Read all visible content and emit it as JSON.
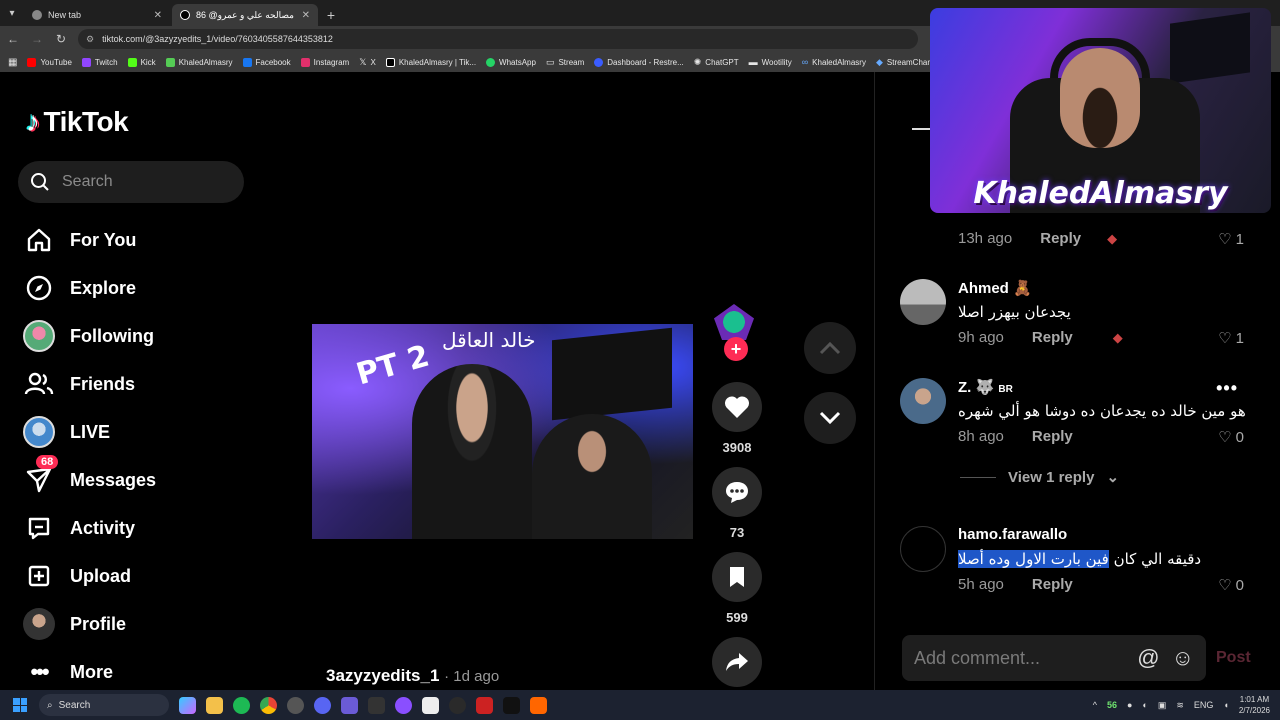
{
  "browser": {
    "tabs": [
      {
        "title": "New tab",
        "active": false
      },
      {
        "title": "مصالحه علي و عمرو@ 86 🔥 ftx",
        "active": true
      }
    ],
    "url": "tiktok.com/@3azyzyedits_1/video/7603405587644353812",
    "bookmarks": [
      "YouTube",
      "Twitch",
      "Kick",
      "KhaledAlmasry",
      "Facebook",
      "Instagram",
      "X",
      "KhaledAlmasry | Tik...",
      "WhatsApp",
      "Stream",
      "Dashboard - Restre...",
      "ChatGPT",
      "Wootility",
      "KhaledAlmasry",
      "StreamCharts"
    ]
  },
  "sidebar": {
    "logo": "TikTok",
    "search_placeholder": "Search",
    "items": [
      {
        "label": "For You",
        "icon": "home-icon"
      },
      {
        "label": "Explore",
        "icon": "compass-icon"
      },
      {
        "label": "Following",
        "icon": "avatar"
      },
      {
        "label": "Friends",
        "icon": "friends-icon"
      },
      {
        "label": "LIVE",
        "icon": "live-avatar"
      },
      {
        "label": "Messages",
        "icon": "messages-icon",
        "badge": "68"
      },
      {
        "label": "Activity",
        "icon": "activity-icon"
      },
      {
        "label": "Upload",
        "icon": "upload-icon"
      },
      {
        "label": "Profile",
        "icon": "profile-avatar"
      },
      {
        "label": "More",
        "icon": "more-icon"
      }
    ]
  },
  "video": {
    "overlay_arabic": "خالد العاقل",
    "overlay_pt": "PT 2",
    "author": "3azyzyedits_1",
    "posted": "· 1d ago"
  },
  "actions": {
    "likes": "3908",
    "comments": "73",
    "saves": "599"
  },
  "comments": [
    {
      "user": "",
      "text": "",
      "time": "13h ago",
      "reply": "Reply",
      "likes": "1"
    },
    {
      "user": "Ahmed 🧸",
      "text": "يجدعان بيهزر اصلا",
      "time": "9h ago",
      "reply": "Reply",
      "likes": "1"
    },
    {
      "user": "Z. 🐺",
      "user_tag": "BR",
      "text": "هو مين خالد ده يجدعان ده دوشا هو ألي شهره",
      "time": "8h ago",
      "reply": "Reply",
      "likes": "0"
    },
    {
      "user": "hamo.farawallo",
      "text_highlight": "فين بارت الاول وده أصلا",
      "text_rest": "دقيقه الي كان",
      "time": "5h ago",
      "reply": "Reply",
      "likes": "0"
    }
  ],
  "view_replies": "View 1 reply",
  "composer": {
    "placeholder": "Add comment...",
    "post": "Post"
  },
  "webcam": {
    "name": "KhaledAlmasry"
  },
  "taskbar": {
    "search": "Search",
    "tray_num": "56",
    "lang": "ENG",
    "time": "1:01 AM",
    "date": "2/7/2026"
  }
}
